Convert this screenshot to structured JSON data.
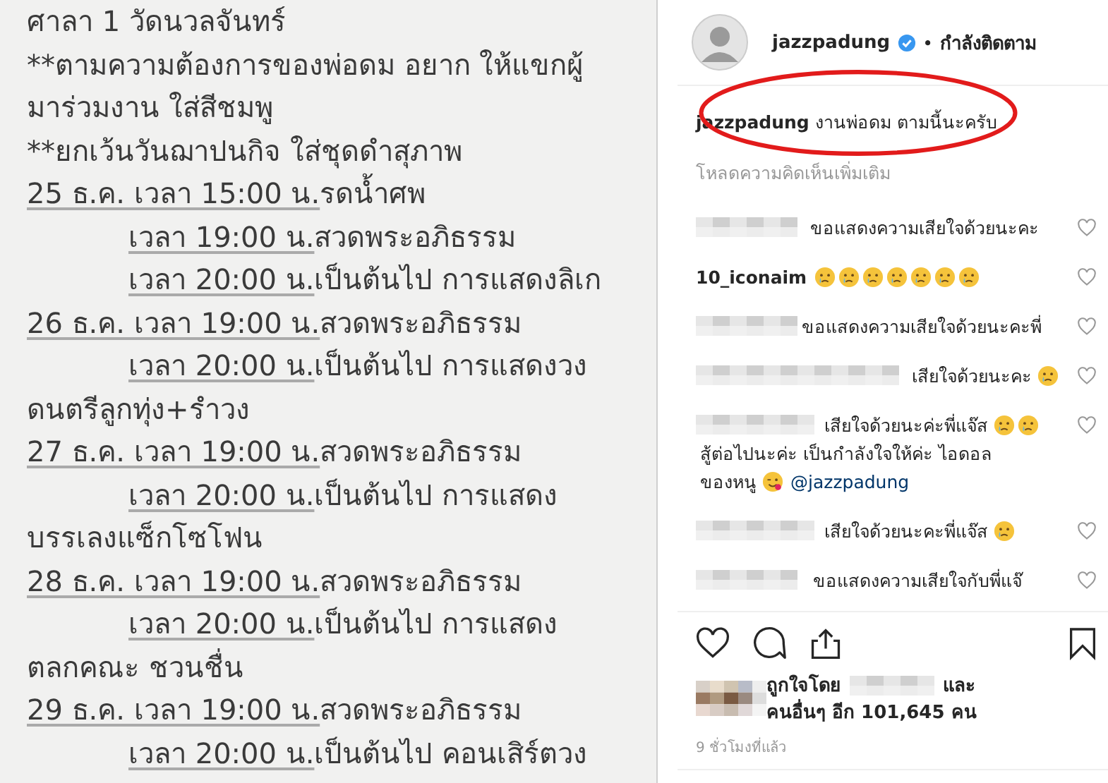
{
  "note": {
    "lines": [
      {
        "text": "ศาลา 1 วัดนวลจันทร์"
      },
      {
        "text": "**ตามความต้องการของพ่อดม อยาก ให้แขกผู้"
      },
      {
        "text": "มาร่วมงาน ใส่สีชมพู"
      },
      {
        "text": "**ยกเว้นวันฌาปนกิจ ใส่ชุดดำสุภาพ"
      },
      {
        "underlined": "25 ธ.ค. เวลา 15:00 น.",
        "text": "รดน้ำศพ",
        "children": [
          {
            "underlined": "เวลา 19:00 น.",
            "text": "สวดพระอภิธรรม"
          },
          {
            "underlined": "เวลา 20:00 น.",
            "text": "เป็นต้นไป การแสดงลิเก"
          }
        ]
      },
      {
        "underlined": "26 ธ.ค. เวลา 19:00 น.",
        "text": "สวดพระอภิธรรม",
        "children": [
          {
            "underlined": "เวลา 20:00 น.",
            "text": "เป็นต้นไป การแสดงวง"
          }
        ]
      },
      {
        "text": "ดนตรีลูกทุ่ง+รำวง"
      },
      {
        "underlined": "27 ธ.ค. เวลา 19:00 น.",
        "text": "สวดพระอภิธรรม",
        "children": [
          {
            "underlined": "เวลา 20:00 น.",
            "text": "เป็นต้นไป การแสดง"
          }
        ]
      },
      {
        "text": "บรรเลงแซ็กโซโฟน"
      },
      {
        "underlined": "28 ธ.ค. เวลา 19:00 น.",
        "text": "สวดพระอภิธรรม",
        "children": [
          {
            "underlined": "เวลา 20:00 น.",
            "text": "เป็นต้นไป การแสดง"
          }
        ]
      },
      {
        "text": "ตลกคณะ ชวนชื่น"
      },
      {
        "underlined": "29 ธ.ค. เวลา 19:00 น.",
        "text": "สวดพระอภิธรรม",
        "children": [
          {
            "underlined": "เวลา 20:00 น.",
            "text": "เป็นต้นไป คอนเสิร์ตวง"
          }
        ]
      }
    ]
  },
  "header": {
    "username": "jazzpadung",
    "verified": true,
    "separator": "•",
    "follow_label": "กำลังติดตาม"
  },
  "caption": {
    "username": "jazzpadung",
    "text": "งานพ่อดม ตามนี้นะครับ"
  },
  "load_more": "โหลดความคิดเห็นเพิ่มเติม",
  "comments": [
    {
      "segments": [
        {
          "kind": "text",
          "text": "ขอแสดงความเสียใจด้วยนะคะ"
        }
      ]
    },
    {
      "username": "10_iconaim",
      "segments": [
        {
          "kind": "crying"
        },
        {
          "kind": "crying"
        },
        {
          "kind": "crying"
        },
        {
          "kind": "crying"
        },
        {
          "kind": "crying"
        },
        {
          "kind": "crying"
        },
        {
          "kind": "crying"
        }
      ]
    },
    {
      "segments": [
        {
          "kind": "text",
          "text": "ขอแสดงความเสียใจด้วยนะคะพี่"
        }
      ]
    },
    {
      "segments": [
        {
          "kind": "text",
          "text": "เสียใจด้วยนะคะ"
        },
        {
          "kind": "crying"
        }
      ]
    },
    {
      "segments": [
        {
          "kind": "text",
          "text": "เสียใจด้วยนะค่ะพี่แจ๊ส"
        },
        {
          "kind": "crying"
        },
        {
          "kind": "crying"
        },
        {
          "kind": "text",
          "text": "สู้ต่อไปนะค่ะ เป็นกำลังใจให้ค่ะ ไอดอล"
        },
        {
          "kind": "text",
          "text": "ของหนู"
        },
        {
          "kind": "wink"
        },
        {
          "kind": "mention",
          "text": "@jazzpadung"
        }
      ]
    },
    {
      "segments": [
        {
          "kind": "text",
          "text": "เสียใจด้วยนะคะพี่แจ๊ส"
        },
        {
          "kind": "crying"
        }
      ]
    },
    {
      "segments": [
        {
          "kind": "text",
          "text": "ขอแสดงความเสียใจกับพี่แจ๊"
        }
      ]
    }
  ],
  "likes": {
    "prefix": "ถูกใจโดย",
    "conjunction": "และ",
    "others": "คนอื่นๆ อีก 101,645 คน"
  },
  "time": "9 ชั่วโมงที่แล้ว"
}
